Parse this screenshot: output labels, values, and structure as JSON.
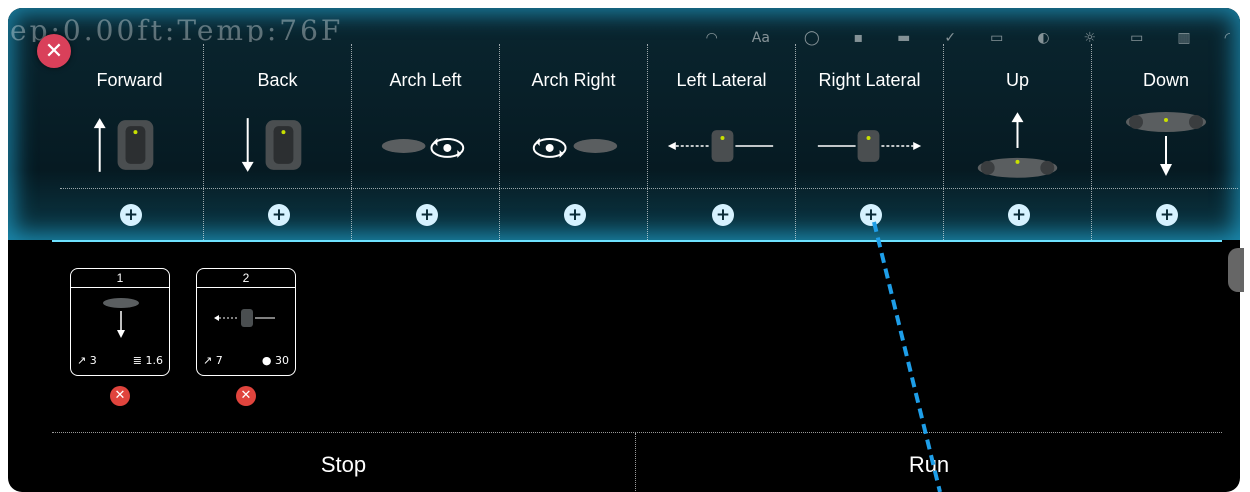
{
  "status_text": "ep:0.00ft:Temp:76F",
  "status_icons": [
    "wifi-icon",
    "text-size-icon",
    "circle-icon",
    "card-icon",
    "battery-icon",
    "check-icon",
    "iso-icon",
    "aperture-icon",
    "brightness-icon",
    "ev-icon",
    "display-icon",
    "corner-icon"
  ],
  "close_label": "✕",
  "actions": [
    {
      "label": "Forward",
      "plus": "+"
    },
    {
      "label": "Back",
      "plus": "+"
    },
    {
      "label": "Arch Left",
      "plus": "+"
    },
    {
      "label": "Arch Right",
      "plus": "+"
    },
    {
      "label": "Left Lateral",
      "plus": "+"
    },
    {
      "label": "Right Lateral",
      "plus": "+"
    },
    {
      "label": "Up",
      "plus": "+"
    },
    {
      "label": "Down",
      "plus": "+"
    }
  ],
  "queue": [
    {
      "number": "1",
      "stat1": "3",
      "stat2": "1.6",
      "stat1_icon": "speed-icon",
      "stat2_icon": "distance-icon"
    },
    {
      "number": "2",
      "stat1": "7",
      "stat2": "30",
      "stat1_icon": "speed-icon",
      "stat2_icon": "clock-icon"
    }
  ],
  "remove_label": "✕",
  "buttons": {
    "stop": "Stop",
    "run": "Run"
  },
  "colors": {
    "accent": "#6fe2ff",
    "close": "#d9405a",
    "remove": "#e0443d",
    "pointer": "#1e9ee8"
  }
}
